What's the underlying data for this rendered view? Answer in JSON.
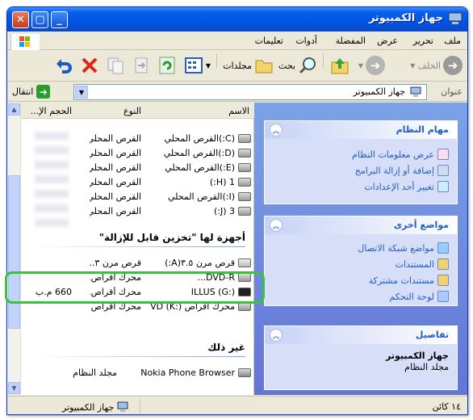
{
  "window": {
    "title": "جهاز الكمبيوتر"
  },
  "menu": [
    "ملف",
    "تحرير",
    "عرض",
    "المفضلة",
    "أدوات",
    "تعليمات"
  ],
  "toolbar": {
    "back": "الخلف",
    "search": "بحث",
    "folders": "مجلدات"
  },
  "address": {
    "label": "عنوان",
    "value": "جهاز الكمبيوتر",
    "go": "انتقال"
  },
  "columns": {
    "name": "الاسم",
    "type": "النوع",
    "size": "الحجم الإ..."
  },
  "drives_local": [
    {
      "name": "(C:)القرص المحلي",
      "type": "القرص المحلي"
    },
    {
      "name": "(D:)القرص المحلي",
      "type": "القرص المحلي"
    },
    {
      "name": "(E:)القرص المحلي",
      "type": "القرص المحلي"
    },
    {
      "name": "1 (H:)",
      "type": "القرص المحلي"
    },
    {
      "name": "(I:)القرص المحلي",
      "type": "القرص المحلي"
    },
    {
      "name": "3 (J:)",
      "type": "القرص المحلي"
    }
  ],
  "group_removable": "أجهزة لها \"تخزين قابل للإزالة\"",
  "drives_removable": [
    {
      "name": "قرص مرن ٣.٥(A:)",
      "type": "قرص مرن ٣....",
      "size": ""
    },
    {
      "name": "DVD-R...",
      "type": "محرك أقراص...",
      "size": ""
    },
    {
      "name": "ILLUS (G:)",
      "type": "محرك أقراص...",
      "size": "660 م.ب"
    },
    {
      "name": "محرك أقراص DVD (K:)",
      "type": "محرك أقراص مضغوطة",
      "size": ""
    }
  ],
  "group_other": "غير ذلك",
  "other": [
    {
      "name": "Nokia Phone Browser",
      "type": "مجلد النظام"
    }
  ],
  "tasks": {
    "title": "مهام النظام",
    "items": [
      "عرض معلومات النظام",
      "إضافة أو إزالة البرامج",
      "تغيير أحد الإعدادات"
    ]
  },
  "places": {
    "title": "مواضع أخرى",
    "items": [
      "مواضع شبكة الاتصال",
      "المستندات",
      "مستندات مشتركة",
      "لوحة التحكم"
    ]
  },
  "details": {
    "title": "تفاصيل",
    "name": "جهاز الكمبيوتر",
    "desc": "مجلد النظام"
  },
  "status": {
    "count": "١٤ كائن",
    "location": "جهاز الكمبيوتر"
  }
}
